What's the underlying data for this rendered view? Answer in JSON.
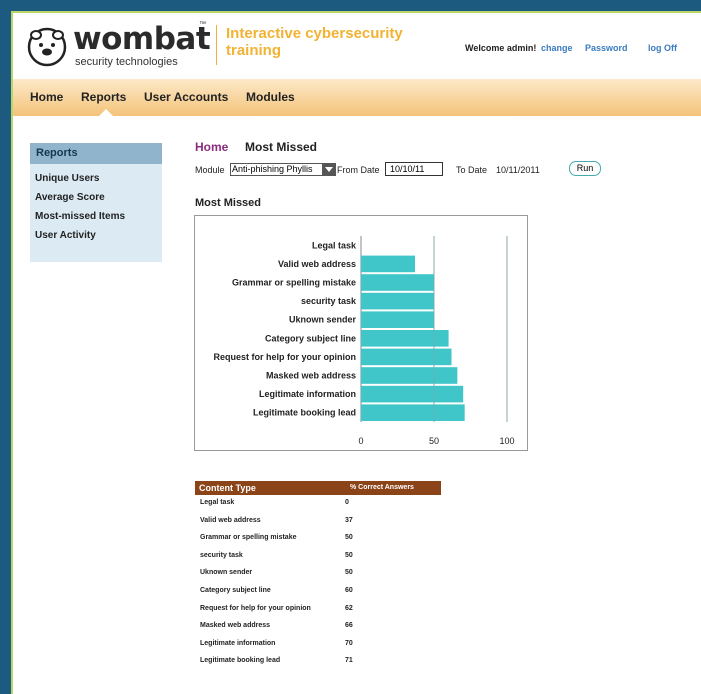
{
  "header": {
    "brand": "wombat",
    "brand_sub": "security technologies",
    "tm": "™",
    "tagline": "Interactive cybersecurity training",
    "welcome": "Welcome admin!",
    "change": "change",
    "password": "Password",
    "logoff": "log Off"
  },
  "nav": {
    "home": "Home",
    "reports": "Reports",
    "user_accounts": "User Accounts",
    "modules": "Modules"
  },
  "sidebar": {
    "title": "Reports",
    "items": [
      "Unique Users",
      "Average Score",
      "Most-missed Items",
      "User Activity"
    ]
  },
  "main": {
    "crumb_home": "Home",
    "crumb_title": "Most Missed",
    "module_label": "Module",
    "module_value": "Anti-phishing Phyllis",
    "from_label": "From Date",
    "from_value": "10/10/11",
    "to_label": "To Date",
    "to_value": "10/11/2011",
    "run": "Run",
    "section_title": "Most Missed"
  },
  "colors": {
    "bar": "#40c6c9",
    "table_header": "#8b4318",
    "brand_orange": "#f2b233"
  },
  "chart_data": {
    "type": "bar",
    "orientation": "horizontal",
    "categories": [
      "Legal task",
      "Valid web address",
      "Grammar or spelling mistake",
      "security task",
      "Uknown sender",
      "Category subject line",
      "Request for help for your opinion",
      "Masked web address",
      "Legitimate information",
      "Legitimate booking lead"
    ],
    "values": [
      0,
      37,
      50,
      50,
      50,
      60,
      62,
      66,
      70,
      71
    ],
    "xlim": [
      0,
      100
    ],
    "xticks": [
      0,
      50,
      100
    ],
    "grid": true
  },
  "table": {
    "col_type": "Content Type",
    "col_pct": "% Correct Answers",
    "rows": [
      {
        "name": "Legal task",
        "value": "0"
      },
      {
        "name": "Valid web address",
        "value": "37"
      },
      {
        "name": "Grammar or spelling mistake",
        "value": "50"
      },
      {
        "name": "security task",
        "value": "50"
      },
      {
        "name": "Uknown sender",
        "value": "50"
      },
      {
        "name": "Category subject line",
        "value": "60"
      },
      {
        "name": "Request for help for your opinion",
        "value": "62"
      },
      {
        "name": "Masked web address",
        "value": "66"
      },
      {
        "name": "Legitimate information",
        "value": "70"
      },
      {
        "name": "Legitimate booking lead",
        "value": "71"
      }
    ]
  }
}
